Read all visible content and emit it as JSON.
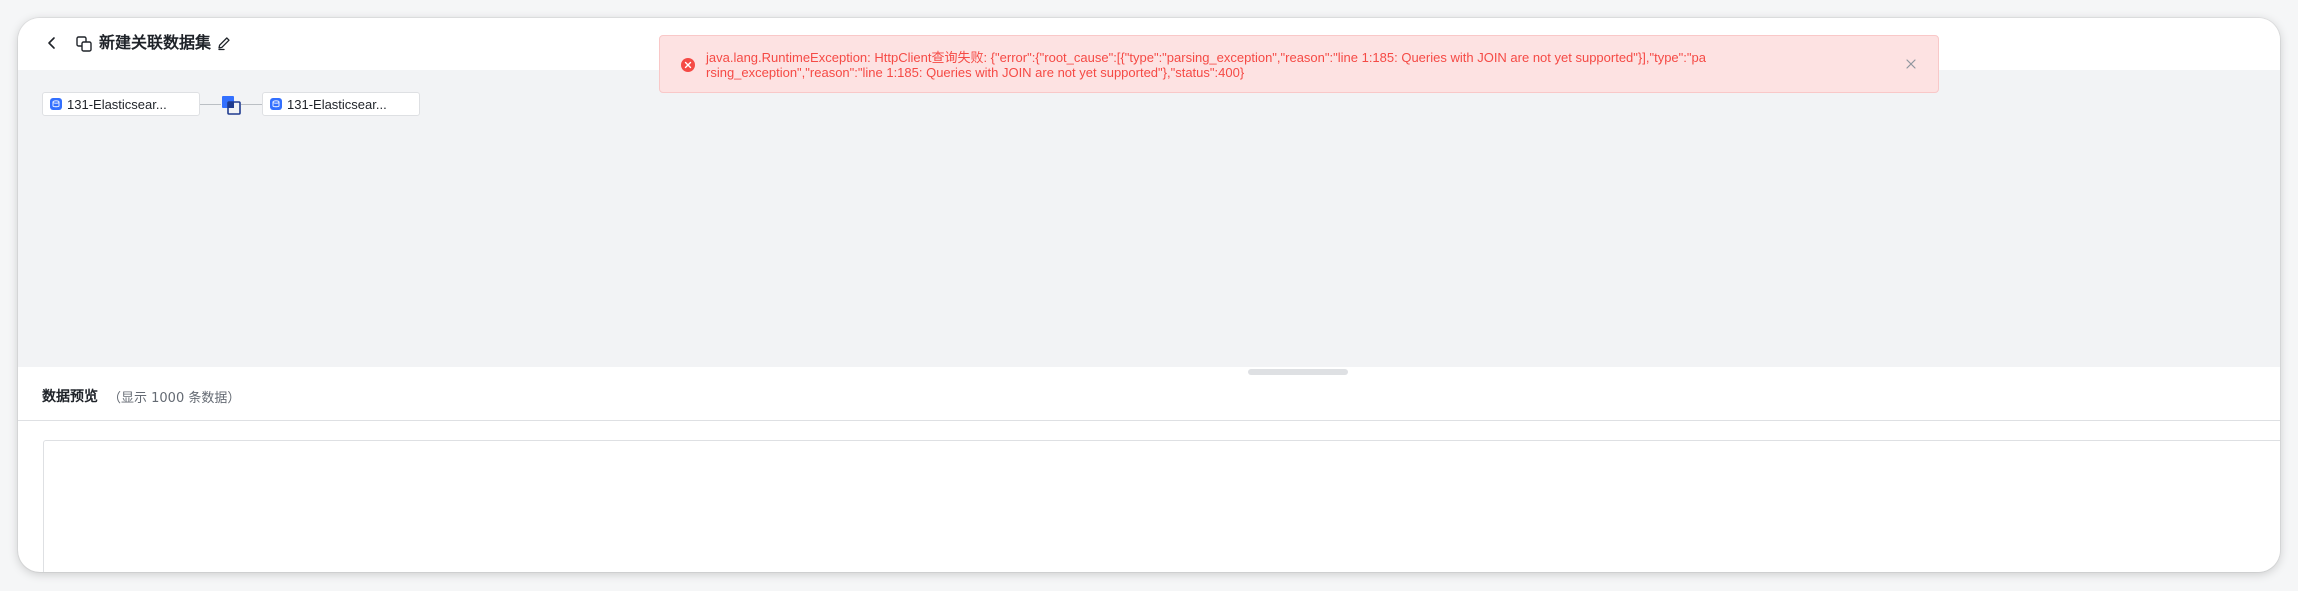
{
  "header": {
    "title": "新建关联数据集"
  },
  "canvas": {
    "nodes": [
      {
        "label": "131-Elasticsear..."
      },
      {
        "label": "131-Elasticsear..."
      }
    ]
  },
  "preview": {
    "title": "数据预览",
    "subtitle": "（显示 1000 条数据）"
  },
  "toast": {
    "message": "java.lang.RuntimeException: HttpClient查询失败: {\"error\":{\"root_cause\":[{\"type\":\"parsing_exception\",\"reason\":\"line 1:185: Queries with JOIN are not yet supported\"}],\"type\":\"parsing_exception\",\"reason\":\"line 1:185: Queries with JOIN are not yet supported\"},\"status\":400}",
    "color": "#f54a45",
    "background": "#fde2e2"
  },
  "colors": {
    "accent": "#3370ff",
    "canvas_bg": "#f2f3f5"
  }
}
